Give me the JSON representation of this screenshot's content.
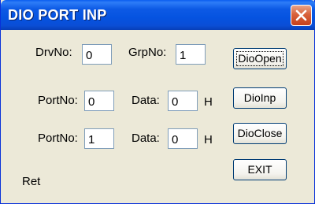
{
  "window": {
    "title": "DIO PORT INP"
  },
  "row1": {
    "drv_label": "DrvNo:",
    "drv_value": "0",
    "grp_label": "GrpNo:",
    "grp_value": "1"
  },
  "row2": {
    "port_label": "PortNo:",
    "port_value": "0",
    "data_label": "Data:",
    "data_value": "0",
    "unit": "H"
  },
  "row3": {
    "port_label": "PortNo:",
    "port_value": "1",
    "data_label": "Data:",
    "data_value": "0",
    "unit": "H"
  },
  "buttons": {
    "open": "DioOpen",
    "inp": "DioInp",
    "close": "DioClose",
    "exit": "EXIT"
  },
  "status": {
    "ret_label": "Ret"
  }
}
